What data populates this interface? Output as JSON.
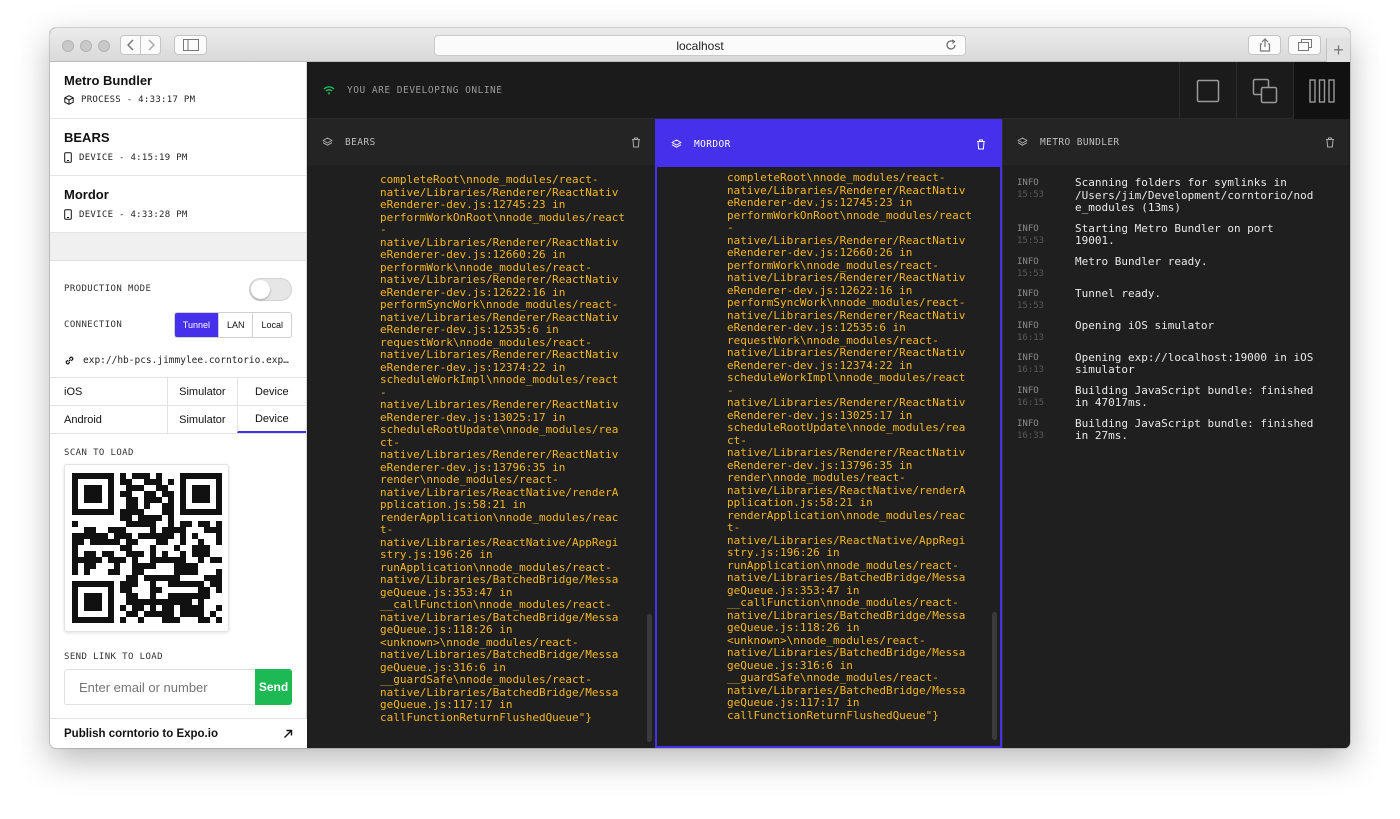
{
  "browser": {
    "url": "localhost"
  },
  "sidebar": {
    "devices": [
      {
        "name": "Metro Bundler",
        "meta": "PROCESS - 4:33:17 PM",
        "icon": "cube-icon"
      },
      {
        "name": "BEARS",
        "meta": "DEVICE - 4:15:19 PM",
        "icon": "phone-icon"
      },
      {
        "name": "Mordor",
        "meta": "DEVICE - 4:33:28 PM",
        "icon": "phone-icon"
      }
    ],
    "production_mode_label": "PRODUCTION MODE",
    "production_mode_on": false,
    "connection_label": "CONNECTION",
    "connection_options": [
      "Tunnel",
      "LAN",
      "Local"
    ],
    "connection_selected": "Tunnel",
    "exp_url": "exp://hb-pcs.jimmylee.corntorio.exp…",
    "platforms": [
      {
        "name": "iOS",
        "simulator": "Simulator",
        "device": "Device"
      },
      {
        "name": "Android",
        "simulator": "Simulator",
        "device": "Device"
      }
    ],
    "scan_label": "SCAN TO LOAD",
    "send_label": "SEND LINK TO LOAD",
    "send_placeholder": "Enter email or number",
    "send_button": "Send",
    "publish_label": "Publish corntorio to Expo.io"
  },
  "main": {
    "online_status": "YOU ARE DEVELOPING ONLINE",
    "accent": "#4630eb",
    "log_color": "#f5b623",
    "columns": [
      {
        "title": "BEARS"
      },
      {
        "title": "MORDOR"
      },
      {
        "title": "METRO BUNDLER"
      }
    ],
    "device_log": "completeRoot\\nnode_modules/react-\nnative/Libraries/Renderer/ReactNativ\neRenderer-dev.js:12745:23 in\nperformWorkOnRoot\\nnode_modules/react\n-\nnative/Libraries/Renderer/ReactNativ\neRenderer-dev.js:12660:26 in\nperformWork\\nnode_modules/react-\nnative/Libraries/Renderer/ReactNativ\neRenderer-dev.js:12622:16 in\nperformSyncWork\\nnode_modules/react-\nnative/Libraries/Renderer/ReactNativ\neRenderer-dev.js:12535:6 in\nrequestWork\\nnode_modules/react-\nnative/Libraries/Renderer/ReactNativ\neRenderer-dev.js:12374:22 in\nscheduleWorkImpl\\nnode_modules/react\n-\nnative/Libraries/Renderer/ReactNativ\neRenderer-dev.js:13025:17 in\nscheduleRootUpdate\\nnode_modules/rea\nct-\nnative/Libraries/Renderer/ReactNativ\neRenderer-dev.js:13796:35 in\nrender\\nnode_modules/react-\nnative/Libraries/ReactNative/renderA\npplication.js:58:21 in\nrenderApplication\\nnode_modules/reac\nt-\nnative/Libraries/ReactNative/AppRegi\nstry.js:196:26 in\nrunApplication\\nnode_modules/react-\nnative/Libraries/BatchedBridge/Messa\ngeQueue.js:353:47 in\n__callFunction\\nnode_modules/react-\nnative/Libraries/BatchedBridge/Messa\ngeQueue.js:118:26 in\n<unknown>\\nnode_modules/react-\nnative/Libraries/BatchedBridge/Messa\ngeQueue.js:316:6 in\n__guardSafe\\nnode_modules/react-\nnative/Libraries/BatchedBridge/Messa\ngeQueue.js:117:17 in\ncallFunctionReturnFlushedQueue\"}",
    "metro_log": [
      {
        "level": "INFO",
        "time": "15:53",
        "msg": "Scanning folders for symlinks in\n/Users/jim/Development/corntorio/nod\ne_modules (13ms)"
      },
      {
        "level": "INFO",
        "time": "15:53",
        "msg": "Starting Metro Bundler on port\n19001."
      },
      {
        "level": "INFO",
        "time": "15:53",
        "msg": "Metro Bundler ready."
      },
      {
        "level": "INFO",
        "time": "15:53",
        "msg": "Tunnel ready."
      },
      {
        "level": "INFO",
        "time": "16:13",
        "msg": "Opening iOS simulator"
      },
      {
        "level": "INFO",
        "time": "16:13",
        "msg": "Opening exp://localhost:19000 in iOS\nsimulator"
      },
      {
        "level": "INFO",
        "time": "16:15",
        "msg": "Building JavaScript bundle: finished\nin 47017ms."
      },
      {
        "level": "INFO",
        "time": "16:33",
        "msg": "Building JavaScript bundle: finished\nin 27ms."
      }
    ]
  }
}
